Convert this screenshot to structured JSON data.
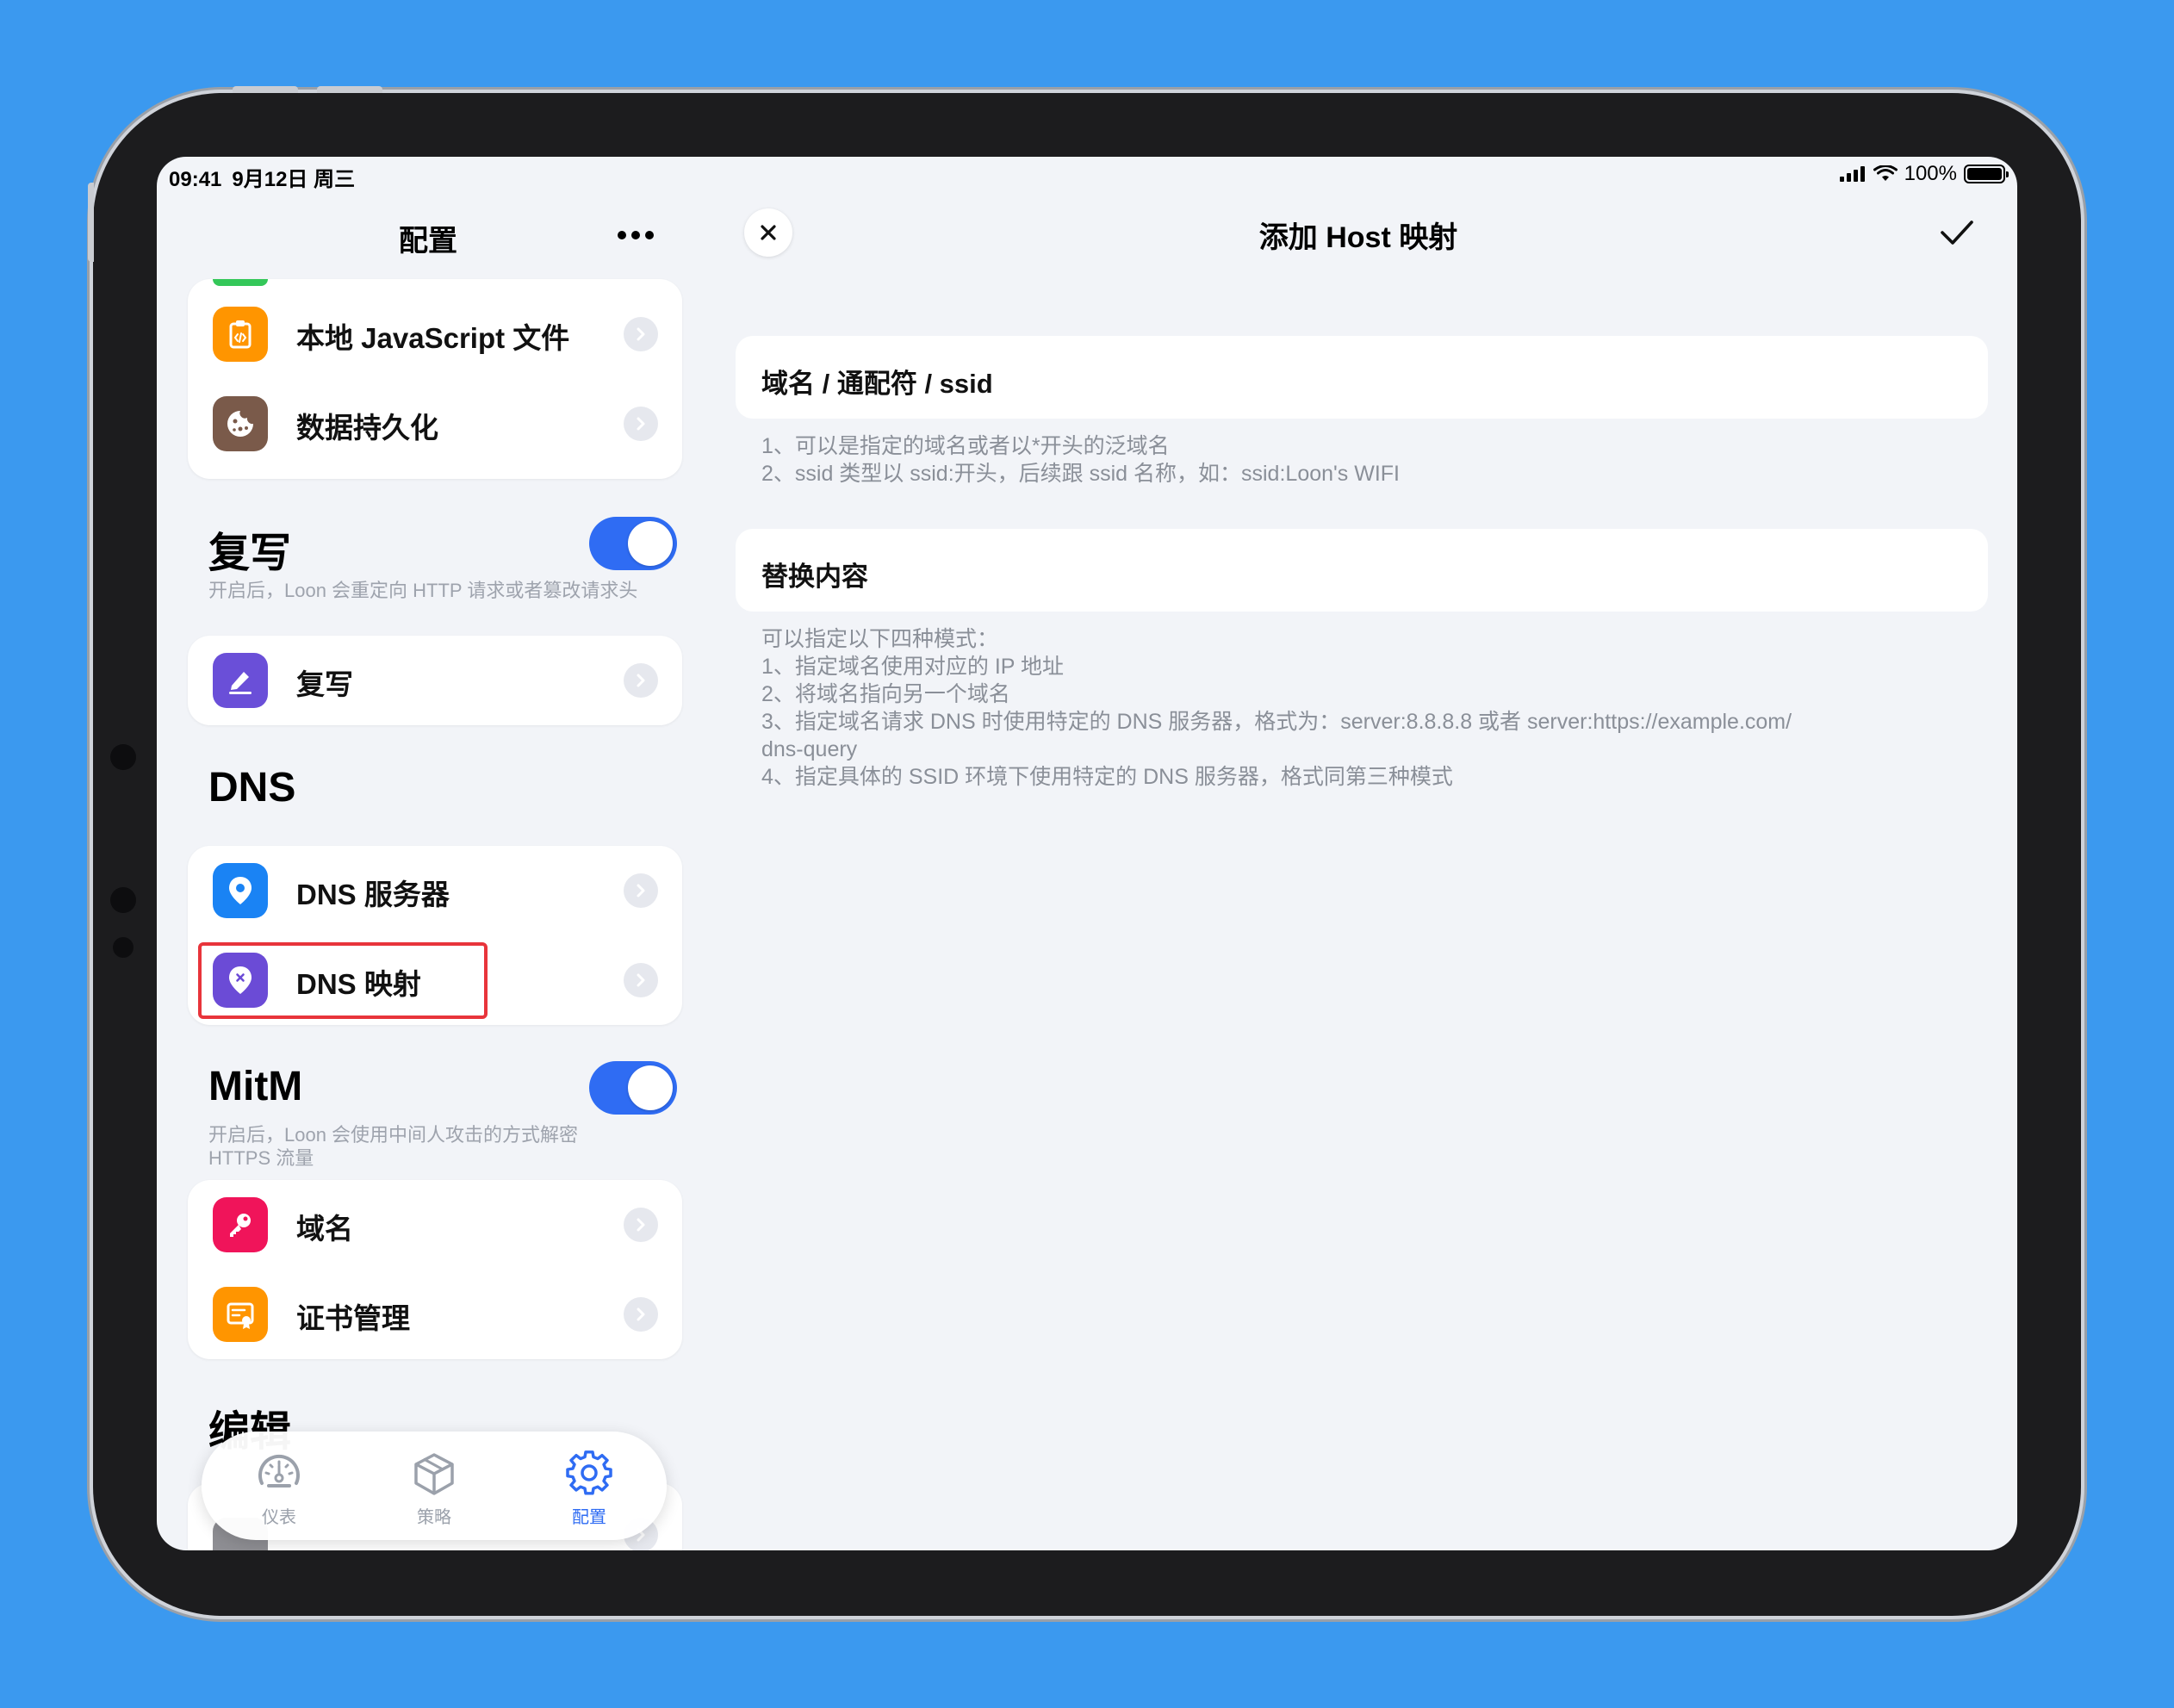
{
  "status_bar": {
    "time": "09:41",
    "date": "9月12日 周三",
    "battery": "100%"
  },
  "sidebar": {
    "title": "配置",
    "items_top": [
      {
        "label": "本地 JavaScript 文件",
        "icon": "js-file-icon",
        "color": "#ff9500"
      },
      {
        "label": "数据持久化",
        "icon": "cookie-icon",
        "color": "#7a5a4a"
      }
    ],
    "rewrite": {
      "title": "复写",
      "enabled": true,
      "description": "开启后，Loon 会重定向 HTTP 请求或者篡改请求头",
      "items": [
        {
          "label": "复写",
          "icon": "rewrite-pen-icon",
          "color": "#6a4fd8"
        }
      ]
    },
    "dns": {
      "title": "DNS",
      "items": [
        {
          "label": "DNS 服务器",
          "icon": "location-pin-icon",
          "color": "#1a83f4"
        },
        {
          "label": "DNS 映射",
          "icon": "map-pin-x-icon",
          "color": "#6b4bd6"
        }
      ]
    },
    "mitm": {
      "title": "MitM",
      "enabled": true,
      "description_line1": "开启后，Loon 会使用中间人攻击的方式解密",
      "description_line2": "HTTPS 流量",
      "items": [
        {
          "label": "域名",
          "icon": "key-icon",
          "color": "#f0145a"
        },
        {
          "label": "证书管理",
          "icon": "certificate-icon",
          "color": "#ff9500"
        }
      ]
    },
    "edit": {
      "title": "编辑"
    }
  },
  "tabbar": {
    "tabs": [
      {
        "label": "仪表",
        "icon": "dashboard-gauge-icon",
        "active": false
      },
      {
        "label": "策略",
        "icon": "cube-icon",
        "active": false
      },
      {
        "label": "配置",
        "icon": "gear-icon",
        "active": true
      }
    ],
    "active_color": "#2f6cf3",
    "inactive_color": "#9ba1ab"
  },
  "detail": {
    "title": "添加 Host 映射",
    "domain_field": {
      "label": "域名 / 通配符 / ssid"
    },
    "domain_notes": [
      "1、可以是指定的域名或者以*开头的泛域名",
      "2、ssid 类型以 ssid:开头，后续跟 ssid 名称，如：ssid:Loon's WIFI"
    ],
    "replace_field": {
      "label": "替换内容"
    },
    "replace_notes": [
      "可以指定以下四种模式：",
      "1、指定域名使用对应的 IP 地址",
      "2、将域名指向另一个域名",
      "3、指定域名请求 DNS 时使用特定的 DNS 服务器，格式为：server:8.8.8.8 或者 server:https://example.com/",
      "dns-query",
      "4、指定具体的 SSID 环境下使用特定的 DNS 服务器，格式同第三种模式"
    ]
  },
  "colors": {
    "background": "#3b99ef",
    "accent": "#2f6cf3",
    "highlight_border": "#e8343b"
  }
}
